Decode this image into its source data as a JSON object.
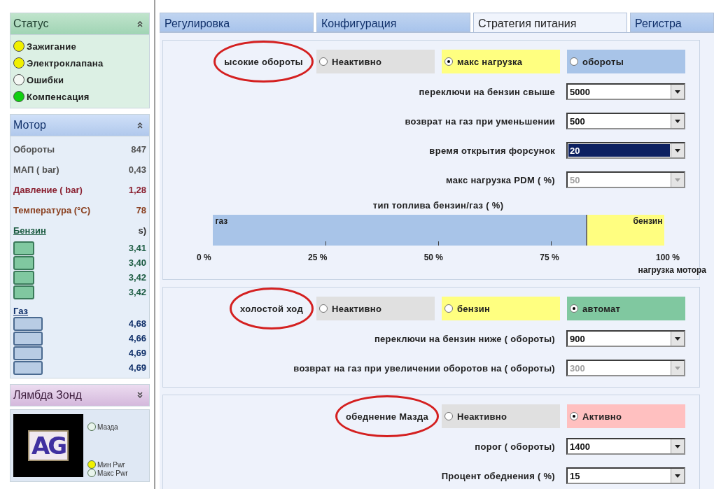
{
  "status": {
    "title": "Статус",
    "items": [
      {
        "label": "Зажигание",
        "color": "#f0f000"
      },
      {
        "label": "Электроклапана",
        "color": "#f0f000"
      },
      {
        "label": "Ошибки",
        "color": "#f4f8f4"
      },
      {
        "label": "Компенсация",
        "color": "#10d010"
      }
    ]
  },
  "motor": {
    "title": "Мотор",
    "rows": [
      {
        "label": "Обороты",
        "value": "847",
        "color": "#505050"
      },
      {
        "label": "МАП ( bar)",
        "value": "0,43",
        "color": "#505050"
      },
      {
        "label": "Давление ( bar)",
        "value": "1,28",
        "color": "#8a2030"
      },
      {
        "label": "Температура (°C)",
        "value": "78",
        "color": "#8a4020"
      }
    ],
    "petrol": {
      "title": "Бензин",
      "unit": "s)",
      "values": [
        "3,41",
        "3,40",
        "3,42",
        "3,42"
      ]
    },
    "gas": {
      "title": "Газ",
      "values": [
        "4,68",
        "4,66",
        "4,69",
        "4,69"
      ]
    }
  },
  "lambda": {
    "title": "Лямбда Зонд",
    "expanded": false,
    "logo_text": "AG",
    "indicators": [
      {
        "label": "Мазда",
        "color": "#e8f4ec"
      },
      {
        "label": "Мин Pwr",
        "color": "#f0f000"
      },
      {
        "label": "Макс Pwr",
        "color": "#e8f4ec"
      }
    ]
  },
  "tabs": [
    {
      "label": "Регулировка",
      "selected": false
    },
    {
      "label": "Конфигурация",
      "selected": false
    },
    {
      "label": "Стратегия питания",
      "selected": true
    },
    {
      "label": "Регистра",
      "selected": false
    }
  ],
  "sections": [
    {
      "label": "ысокие обороты",
      "options": [
        {
          "label": "Неактивно",
          "selected": false,
          "color": "#e0e0e0"
        },
        {
          "label": "макс нагрузка",
          "selected": true,
          "color": "#ffff80"
        },
        {
          "label": "обороты",
          "selected": false,
          "color": "#a8c4e8"
        }
      ],
      "fields": [
        {
          "label": "переключи на бензин свыше",
          "value": "5000",
          "disabled": false,
          "focused": false
        },
        {
          "label": "возврат на газ при уменьшении",
          "value": "500",
          "disabled": false,
          "focused": false
        },
        {
          "label": "время открытия форсунок",
          "value": "20",
          "disabled": false,
          "focused": true
        },
        {
          "label": "макс нагрузка PDM ( %)",
          "value": "50",
          "disabled": true,
          "focused": false
        }
      ],
      "fuel_bar": {
        "title": "тип топлива бензин/газ ( %)",
        "gas_label": "газ",
        "petrol_label": "бензин",
        "level": 0.83,
        "ticks": [
          "0 %",
          "25 %",
          "50 %",
          "75 %",
          "100 %"
        ],
        "axis_label": "нагрузка мотора"
      }
    },
    {
      "label": "холостой ход",
      "options": [
        {
          "label": "Неактивно",
          "selected": false,
          "color": "#e0e0e0"
        },
        {
          "label": "бензин",
          "selected": false,
          "color": "#ffff80"
        },
        {
          "label": "автомат",
          "selected": true,
          "color": "#80c8a0"
        }
      ],
      "fields": [
        {
          "label": "переключи на бензин ниже ( обороты)",
          "value": "900",
          "disabled": false,
          "focused": false
        },
        {
          "label": "возврат на газ при увеличении оборотов на ( обороты)",
          "value": "300",
          "disabled": true,
          "focused": false
        }
      ]
    },
    {
      "label": "обеднение Мазда",
      "options": [
        {
          "label": "Неактивно",
          "selected": false,
          "color": "#e0e0e0"
        },
        {
          "label": "Активно",
          "selected": true,
          "color": "#ffc0c0"
        }
      ],
      "fields": [
        {
          "label": "порог ( обороты)",
          "value": "1400",
          "disabled": false,
          "focused": false
        },
        {
          "label": "Процент обеднения ( %)",
          "value": "15",
          "disabled": false,
          "focused": false
        }
      ]
    }
  ]
}
